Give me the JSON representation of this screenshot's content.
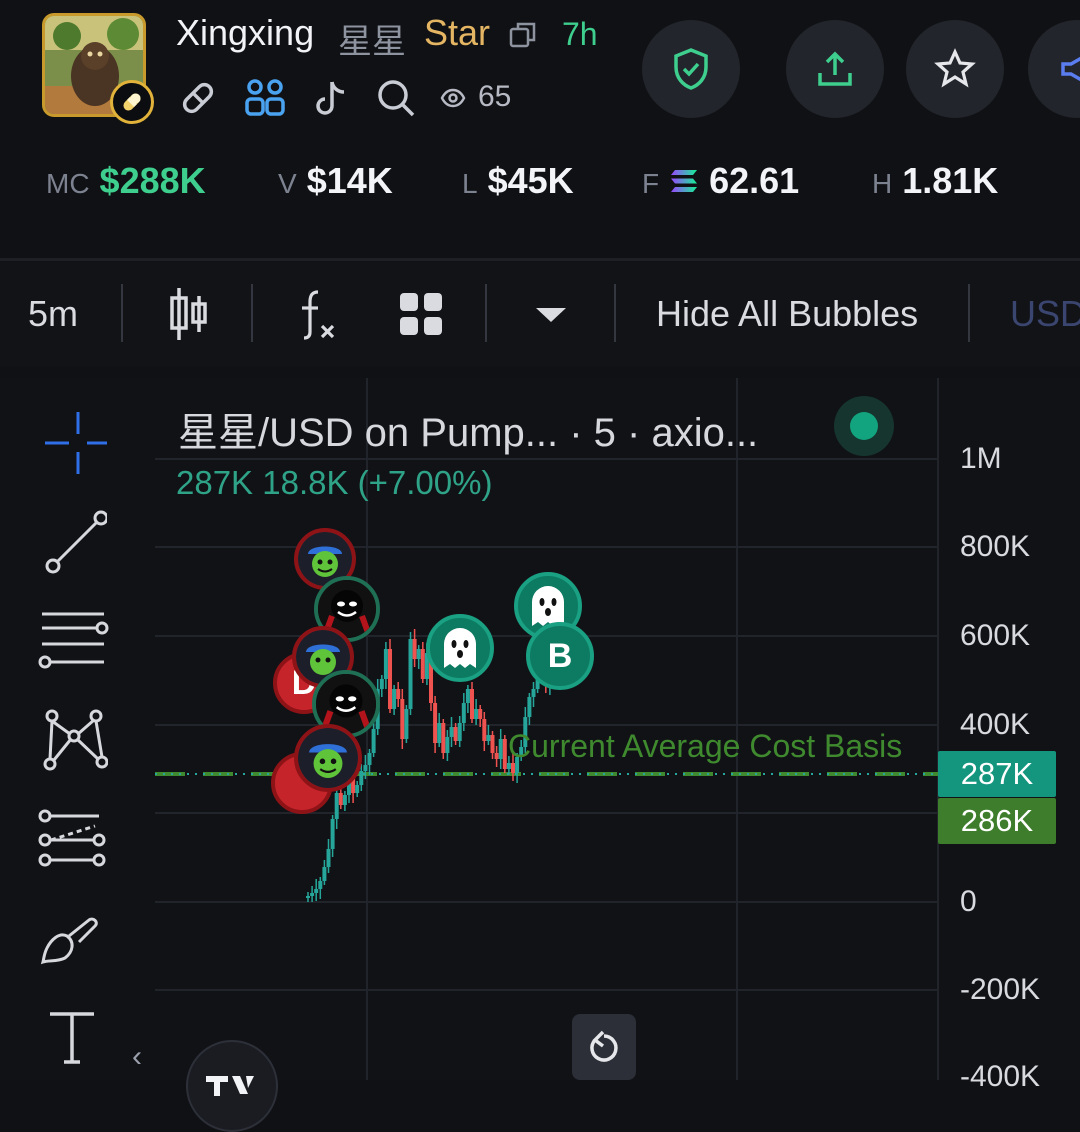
{
  "header": {
    "name": "Xingxing",
    "subname": "星星",
    "ticker": "Star",
    "age": "7h",
    "views": "65"
  },
  "stats": {
    "mc_label": "MC",
    "mc_value": "$288K",
    "v_label": "V",
    "v_value": "$14K",
    "l_label": "L",
    "l_value": "$45K",
    "f_label": "F",
    "f_value": "62.61",
    "h_label": "H",
    "h_value": "1.81K"
  },
  "toolbar": {
    "interval": "5m",
    "hide_bubbles": "Hide All Bubbles",
    "currency": "USD"
  },
  "chart": {
    "title": "星星/USD on Pump... · 5 · axio...",
    "ohlc": "287K  18.8K (+7.00%)",
    "y_ticks": [
      "1M",
      "800K",
      "600K",
      "400K",
      "0",
      "-200K",
      "-400K"
    ],
    "price_tag_current": "287K",
    "price_tag_cost": "286K",
    "cost_basis_label": "Current Average Cost Basis",
    "bubble_buy_label": "B",
    "bubble_sell_label": "D",
    "collapse_glyph": "‹",
    "colors": {
      "up": "#26a69a",
      "down": "#ef5350",
      "cost": "#3f8a2e",
      "accent": "#3ecf8e"
    }
  }
}
